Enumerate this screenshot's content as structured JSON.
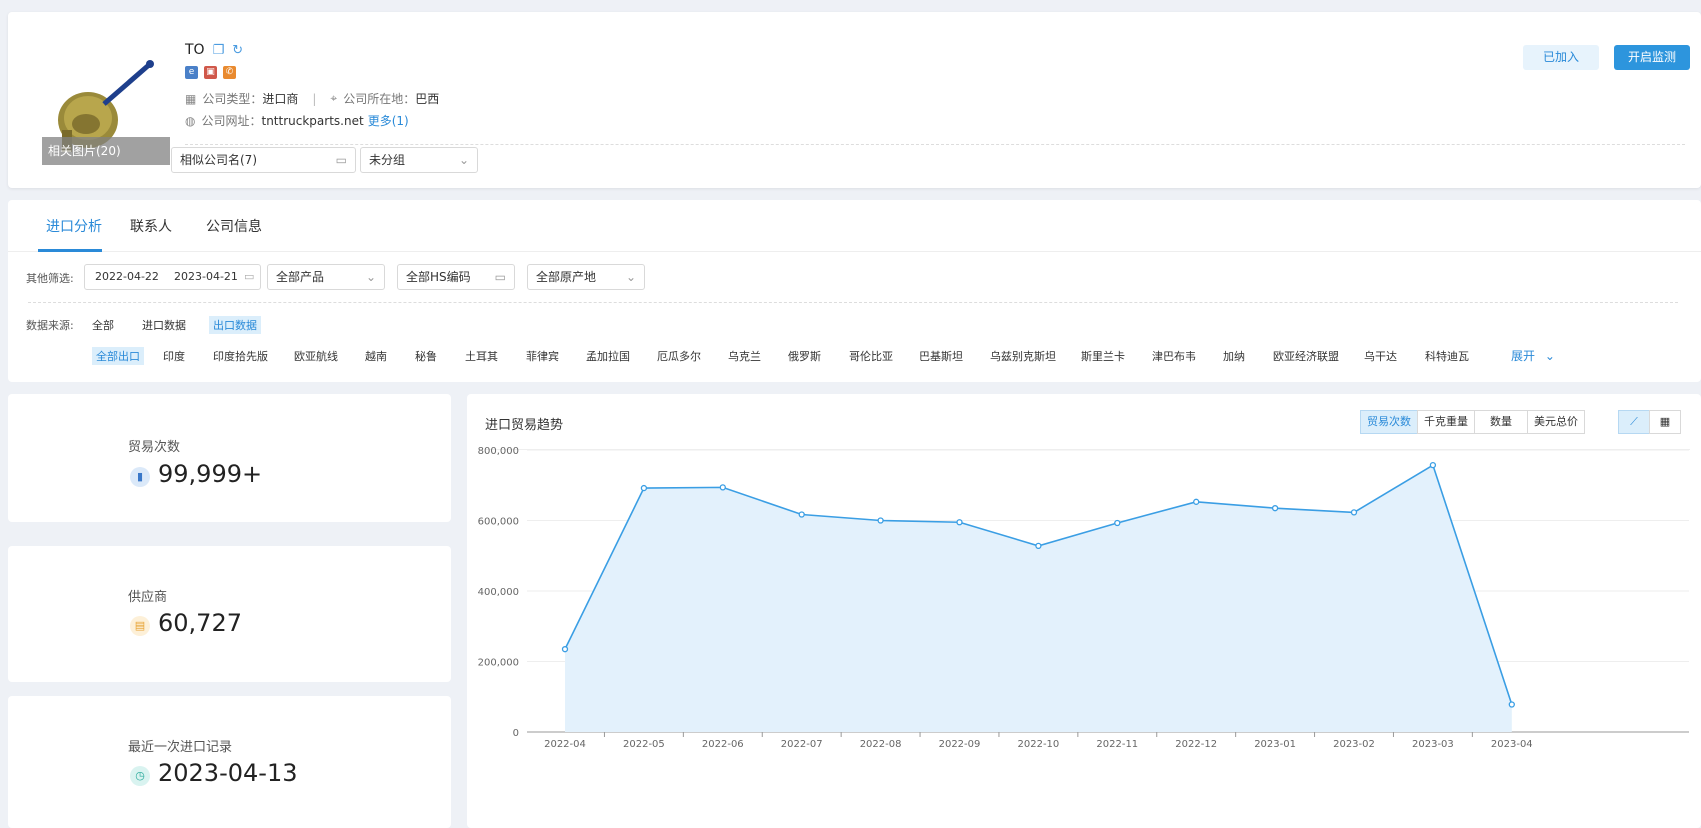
{
  "company": {
    "name": "TO",
    "photo_caption": "相关图片(20)",
    "type_label": "公司类型：",
    "type_value": "进口商",
    "location_label": "公司所在地：",
    "location_value": "巴西",
    "website_label": "公司网址：",
    "website_value": "tnttruckparts.net",
    "more_link": "更多(1)",
    "similar_select": "相似公司名(7)",
    "group_select": "未分组",
    "joined_button": "已加入",
    "monitor_button": "开启监测"
  },
  "tabs": [
    "进口分析",
    "联系人",
    "公司信息"
  ],
  "filters": {
    "other_label": "其他筛选:",
    "date_start": "2022-04-22",
    "date_end": "2023-04-21",
    "product_select": "全部产品",
    "hs_select": "全部HS编码",
    "origin_select": "全部原产地",
    "source_label": "数据来源:",
    "sources": [
      "全部",
      "进口数据",
      "出口数据"
    ],
    "countries": [
      "全部出口",
      "印度",
      "印度拾先版",
      "欧亚航线",
      "越南",
      "秘鲁",
      "土耳其",
      "菲律宾",
      "孟加拉国",
      "厄瓜多尔",
      "乌克兰",
      "俄罗斯",
      "哥伦比亚",
      "巴基斯坦",
      "乌兹别克斯坦",
      "斯里兰卡",
      "津巴布韦",
      "加纳",
      "欧亚经济联盟",
      "乌干达",
      "科特迪瓦"
    ],
    "expand": "展开"
  },
  "stats": {
    "trades_label": "贸易次数",
    "trades_value": "99,999+",
    "suppliers_label": "供应商",
    "suppliers_value": "60,727",
    "last_label": "最近一次进口记录",
    "last_value": "2023-04-13"
  },
  "chart_panel": {
    "title": "进口贸易趋势",
    "metrics": [
      "贸易次数",
      "千克重量",
      "数量",
      "美元总价"
    ],
    "active_metric": "贸易次数"
  },
  "colors": {
    "accent": "#2a8ad8",
    "line": "#3a9ee4",
    "area": "#e3f1fc"
  },
  "chart_data": {
    "type": "area",
    "title": "进口贸易趋势",
    "x": [
      "2022-04",
      "2022-05",
      "2022-06",
      "2022-07",
      "2022-08",
      "2022-09",
      "2022-10",
      "2022-11",
      "2022-12",
      "2023-01",
      "2023-02",
      "2023-03",
      "2023-04"
    ],
    "series": [
      {
        "values": [
          235000,
          692000,
          694000,
          617000,
          600000,
          595000,
          528000,
          593000,
          653000,
          635000,
          623000,
          757000,
          78000
        ]
      }
    ],
    "ylim": [
      0,
      800000
    ],
    "yticks": [
      "0",
      "200,000",
      "400,000",
      "600,000",
      "800,000"
    ],
    "grid": true
  }
}
